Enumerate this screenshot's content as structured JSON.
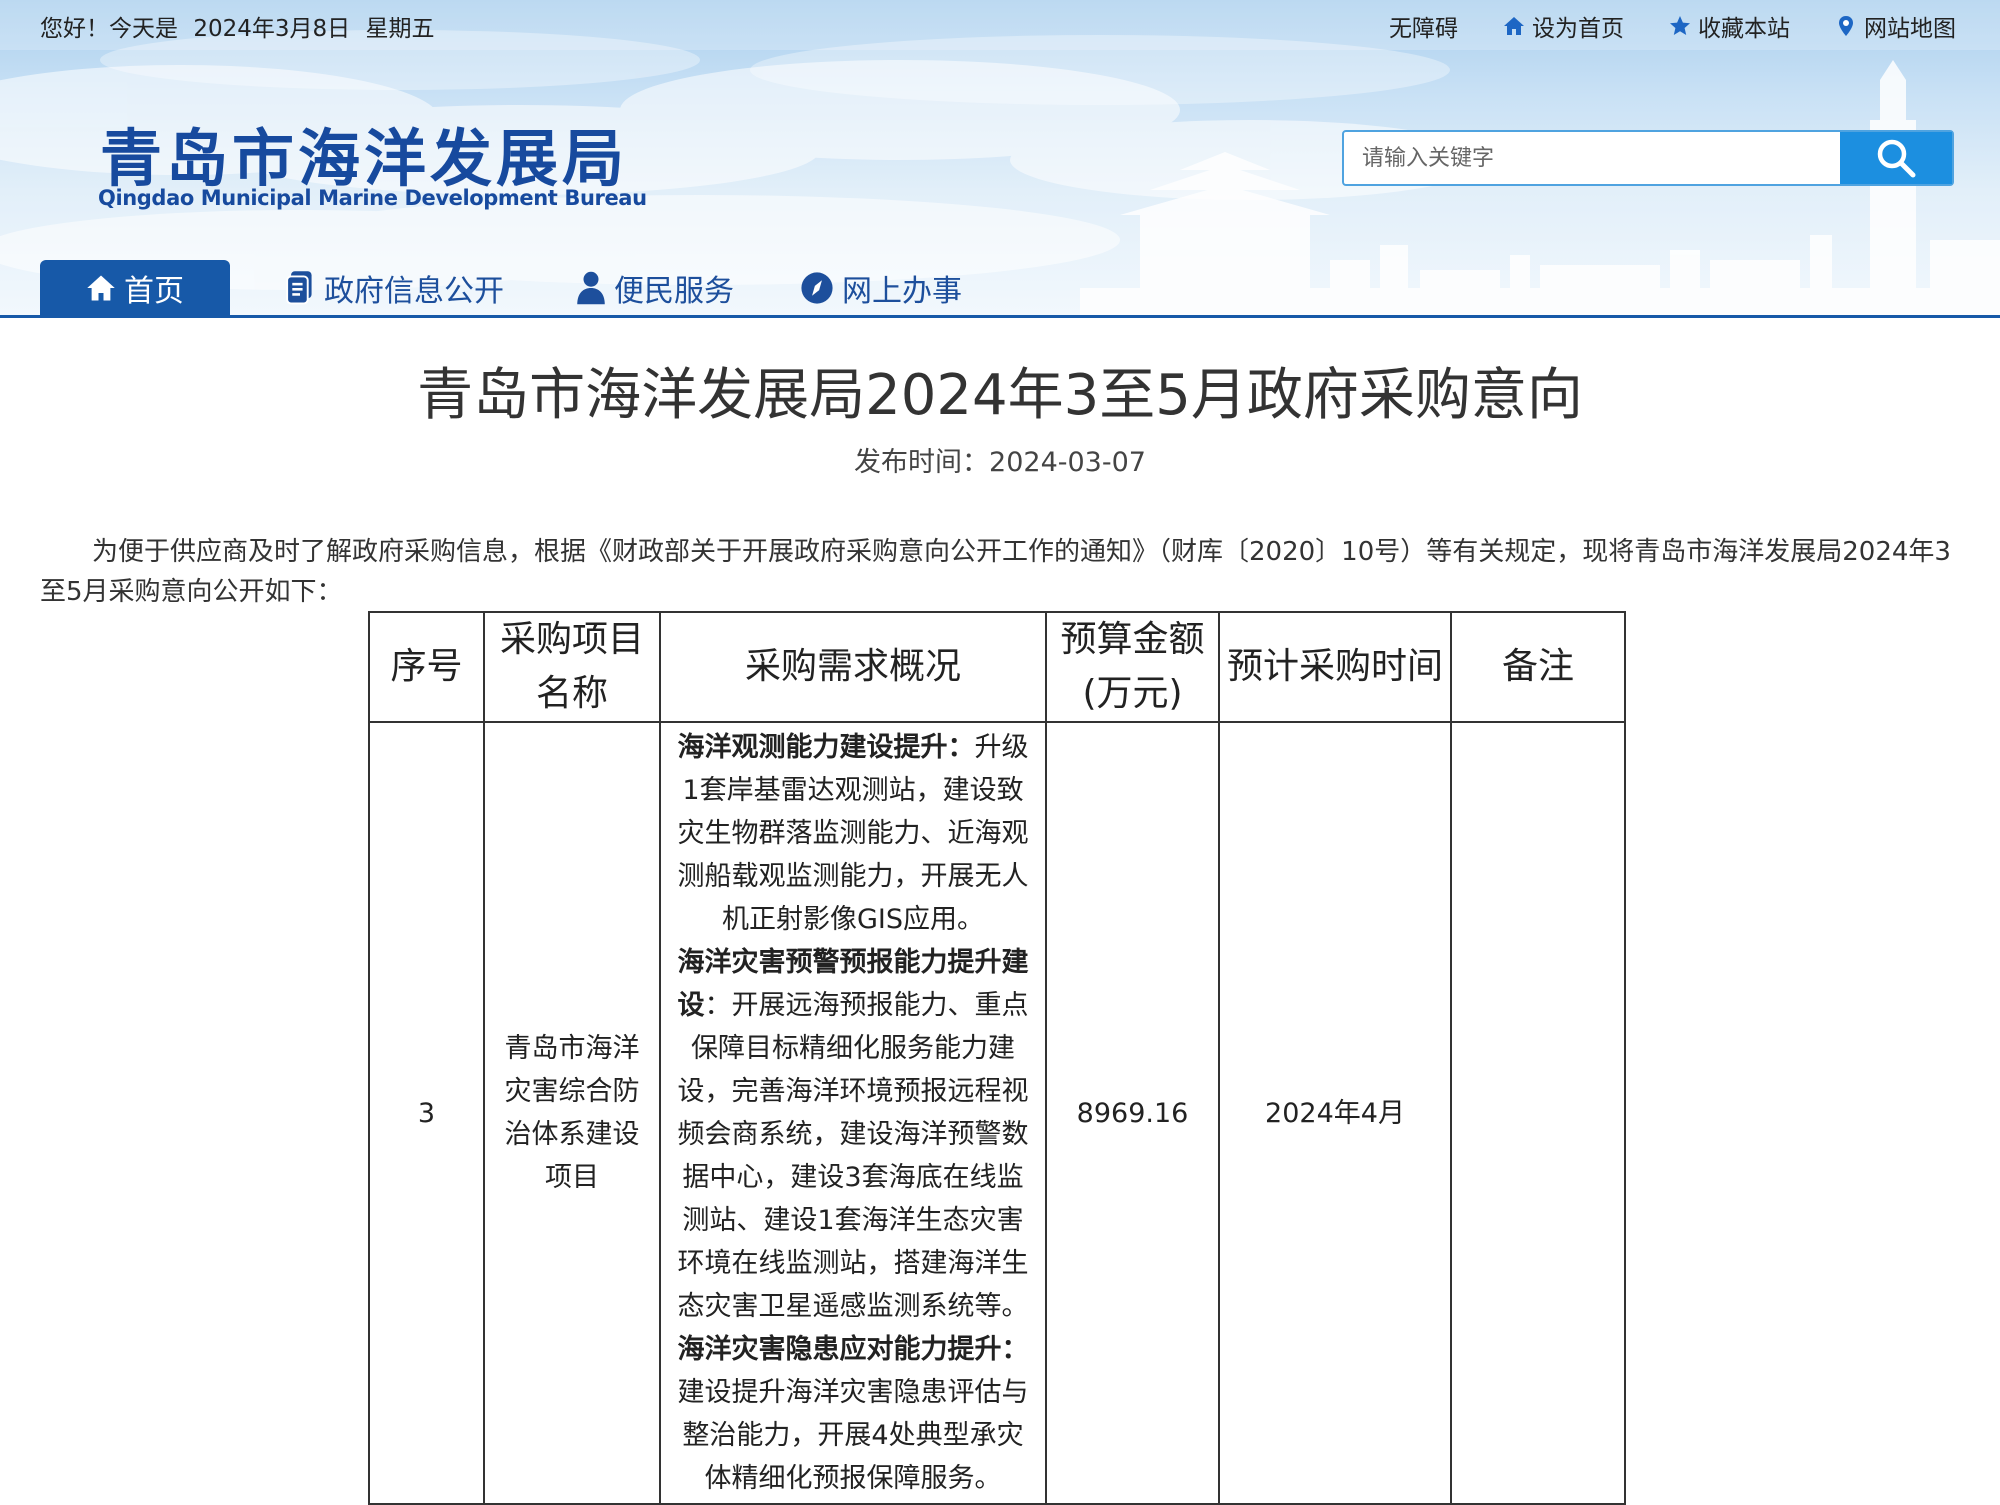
{
  "topbar": {
    "greeting": "您好！今天是",
    "date": "2024年3月8日",
    "weekday": "星期五",
    "links": [
      {
        "label": "无障碍",
        "icon": "none"
      },
      {
        "label": "设为首页",
        "icon": "home-icon"
      },
      {
        "label": "收藏本站",
        "icon": "star-icon"
      },
      {
        "label": "网站地图",
        "icon": "location-pin-icon"
      }
    ]
  },
  "logo": {
    "cn": "青岛市海洋发展局",
    "en": "Qingdao Municipal Marine Development Bureau"
  },
  "search": {
    "placeholder": "请输入关键字"
  },
  "nav": {
    "items": [
      {
        "label": "首页"
      },
      {
        "label": "政府信息公开"
      },
      {
        "label": "便民服务"
      },
      {
        "label": "网上办事"
      }
    ]
  },
  "article": {
    "title": "青岛市海洋发展局2024年3至5月政府采购意向",
    "pubtime": "发布时间：2024-03-07",
    "intro": "为便于供应商及时了解政府采购信息，根据《财政部关于开展政府采购意向公开工作的通知》（财库〔2020〕10号）等有关规定，现将青岛市海洋发展局2024年3至5月采购意向公开如下："
  },
  "table": {
    "headers": [
      "序号",
      "采购项目名称",
      "采购需求概况",
      "预算金额(万元)",
      "预计采购时间",
      "备注"
    ],
    "rows": [
      {
        "no": "3",
        "name": "青岛市海洋灾害综合防治体系建设项目",
        "desc": [
          {
            "head": "海洋观测能力建设提升：",
            "body": "升级1套岸基雷达观测站，建设致灾生物群落监测能力、近海观测船载观监测能力，开展无人机正射影像GIS应用。"
          },
          {
            "head": "海洋灾害预警预报能力提升建设",
            "body": "：开展远海预报能力、重点保障目标精细化服务能力建设，完善海洋环境预报远程视频会商系统，建设海洋预警数据中心，建设3套海底在线监测站、建设1套海洋生态灾害环境在线监测站，搭建海洋生态灾害卫星遥感监测系统等。"
          },
          {
            "head": "海洋灾害隐患应对能力提升：",
            "body": "建设提升海洋灾害隐患评估与整治能力，开展4处典型承灾体精细化预报保障服务。"
          }
        ],
        "budget": "8969.16",
        "time": "2024年4月",
        "note": ""
      }
    ]
  },
  "colors": {
    "brand_blue": "#174a9e",
    "nav_active": "#1759a8",
    "search_button": "#1c8fe0"
  }
}
